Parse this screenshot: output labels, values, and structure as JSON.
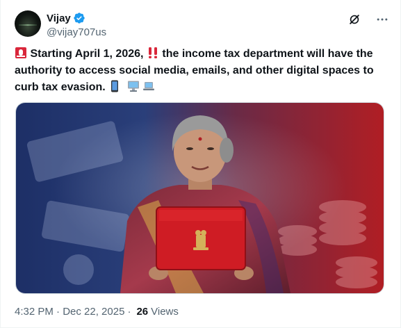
{
  "tweet": {
    "author": {
      "display_name": "Vijay",
      "handle": "@vijay707us",
      "verified": true
    },
    "text": {
      "segment_1": "Starting April 1, 2026,",
      "segment_2": "the income tax department will have the authority to access social media, emails, and other digital spaces to curb tax evasion."
    },
    "emojis": [
      "police-light-icon",
      "double-exclamation-icon",
      "mobile-phone-icon",
      "desktop-computer-icon",
      "laptop-icon"
    ],
    "timestamp": "4:32 PM · Dec 22, 2025",
    "views_count": "26",
    "views_label": "Views"
  },
  "icons": {
    "verified_color": "#1d9bf0",
    "grok": "grok-icon",
    "more": "more-icon"
  }
}
